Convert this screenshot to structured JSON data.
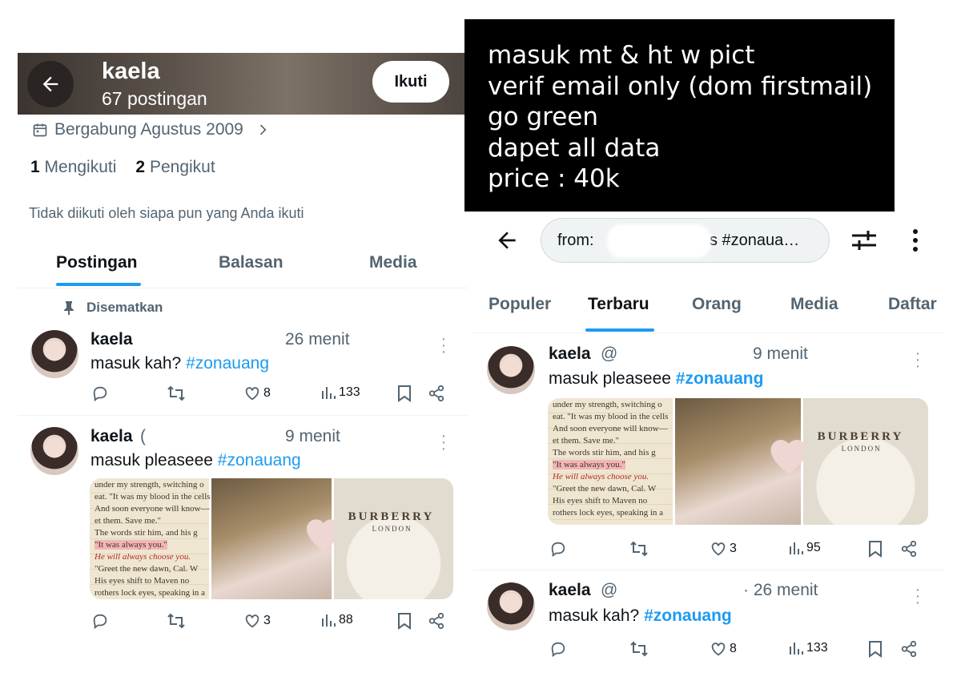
{
  "left": {
    "header": {
      "name": "kaela",
      "post_count": "67 postingan",
      "follow_button": "Ikuti"
    },
    "joined": "Bergabung Agustus 2009",
    "following_count": "1",
    "following_label": "Mengikuti",
    "followers_count": "2",
    "followers_label": "Pengikut",
    "not_followed": "Tidak diikuti oleh siapa pun yang Anda ikuti",
    "tabs": [
      "Postingan",
      "Balasan",
      "Media"
    ],
    "pinned_label": "Disematkan",
    "tweets": [
      {
        "name": "kaela",
        "handle": "",
        "time": "26 menit",
        "text": "masuk kah?",
        "hashtag": "#zonauang",
        "likes": "8",
        "views": "133"
      },
      {
        "name": "kaela",
        "handle": "(",
        "time": "9 menit",
        "text": "masuk pleaseee",
        "hashtag": "#zonauang",
        "likes": "3",
        "views": "88"
      }
    ]
  },
  "right": {
    "promo_lines": [
      "masuk mt & ht w pict",
      "verif email only (dom firstmail)",
      "go green",
      "dapet all data",
      "price : 40k"
    ],
    "search": {
      "value_start": "from:",
      "value_end": "s #zonaua…"
    },
    "tabs": [
      "Populer",
      "Terbaru",
      "Orang",
      "Media",
      "Daftar"
    ],
    "tweets": [
      {
        "name": "kaela",
        "handle": "@",
        "time": "9 menit",
        "text": "masuk pleaseee",
        "hashtag": "#zonauang",
        "likes": "3",
        "views": "95"
      },
      {
        "name": "kaela",
        "handle": "@",
        "time": "· 26 menit",
        "text": "masuk kah?",
        "hashtag": "#zonauang",
        "likes": "8",
        "views": "133"
      }
    ]
  },
  "media_text": {
    "book_lines": [
      "under my strength, switching o",
      "eat. \"It was my blood in the cells",
      "And soon everyone will know—",
      "et them. Save me.\"",
      "The words stir him, and his g",
      "\"It was always you.\"",
      "He will always choose you.",
      "\"Greet the new dawn, Cal. W",
      "His eyes shift to Maven no",
      "rothers lock eyes, speaking in a"
    ],
    "brand": "BURBERRY",
    "brand_sub": "LONDON"
  },
  "colors": {
    "accent": "#1d9bf0",
    "text": "#0f1419",
    "muted": "#536471",
    "promo_bg": "#000000"
  }
}
